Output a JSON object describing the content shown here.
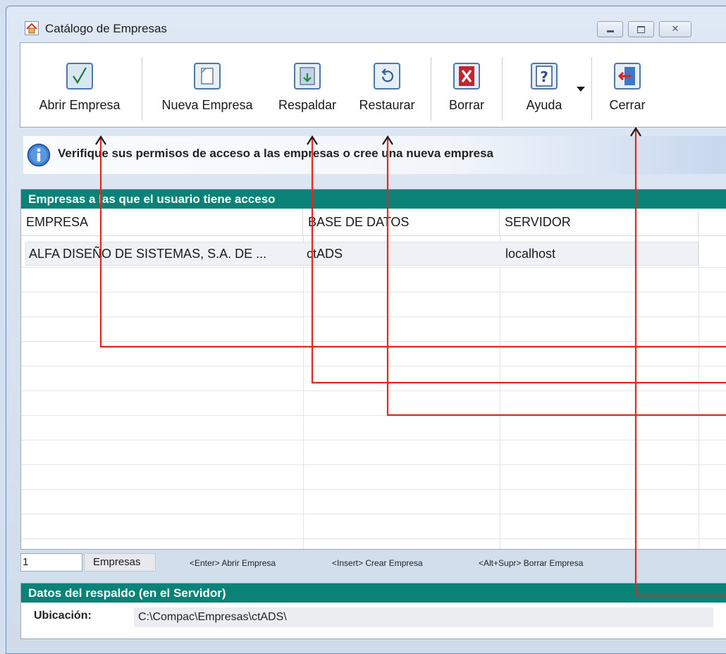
{
  "window": {
    "title": "Catálogo de Empresas",
    "controls": [
      "minimize",
      "maximize",
      "close"
    ]
  },
  "toolbar": {
    "buttons": [
      {
        "label": "Abrir Empresa",
        "icon": "check-icon"
      },
      {
        "label": "Nueva Empresa",
        "icon": "new-document-icon"
      },
      {
        "label": "Respaldar",
        "icon": "backup-icon"
      },
      {
        "label": "Restaurar",
        "icon": "restore-icon"
      },
      {
        "label": "Borrar",
        "icon": "delete-icon"
      },
      {
        "label": "Ayuda",
        "icon": "help-icon"
      },
      {
        "label": "Cerrar",
        "icon": "exit-icon"
      }
    ]
  },
  "info": {
    "message": "Verifique sus permisos de acceso a las empresas o cree una nueva empresa"
  },
  "companies": {
    "section_title": "Empresas a las que el usuario tiene acceso",
    "columns": [
      "EMPRESA",
      "BASE DE DATOS",
      "SERVIDOR"
    ],
    "rows": [
      [
        "ALFA DISEÑO DE SISTEMAS, S.A. DE ...",
        "ctADS",
        "localhost"
      ]
    ]
  },
  "status": {
    "count": "1",
    "label": "Empresas",
    "hints": [
      "<Enter> Abrir Empresa",
      "<Insert> Crear Empresa",
      "<Alt+Supr> Borrar Empresa"
    ]
  },
  "backup": {
    "section_title": "Datos del respaldo (en el Servidor)",
    "location_label": "Ubicación:",
    "location_value": "C:\\Compac\\Empresas\\ctADS\\"
  },
  "colors": {
    "accent_header": "#0a8277",
    "annotation_arrow": "#e8251a"
  }
}
